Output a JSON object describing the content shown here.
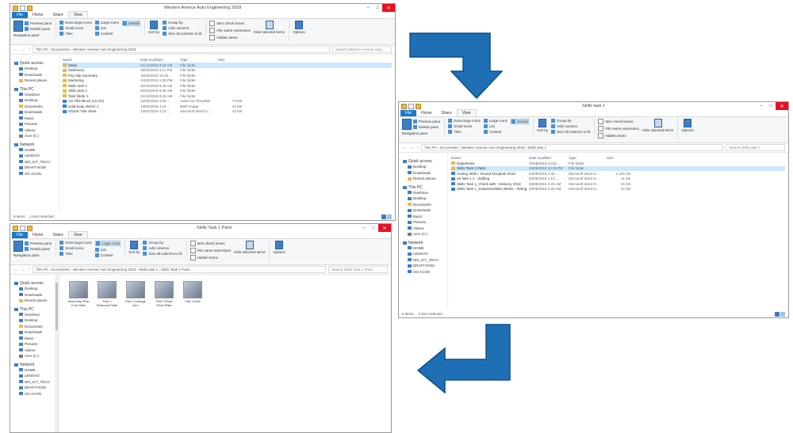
{
  "win1": {
    "title": "Western Avenue Auto Engineering 2018",
    "tabs": [
      "File",
      "Home",
      "Share",
      "View"
    ],
    "ribbon": {
      "nav_pane": "Navigation pane",
      "panes": [
        "Preview pane",
        "Details pane"
      ],
      "layout": [
        "Extra large icons",
        "Large icons",
        "Small icons",
        "List",
        "Tiles",
        "Content"
      ],
      "layout_selected": "Details",
      "sort": "Sort by",
      "current_view": [
        "Group by",
        "Add columns",
        "Size all columns to fit"
      ],
      "show_hide": [
        "Item check boxes",
        "File name extensions",
        "Hidden items"
      ],
      "hide_selected": "Hide selected items",
      "options": "Options"
    },
    "path": "This PC  ›  Documents  ›  Western Avenue Auto Engineering 2018",
    "search_placeholder": "Search Western Avenue Auto...",
    "columns": [
      "Name",
      "Date modified",
      "Type",
      "Size"
    ],
    "files": [
      {
        "name": "Sales",
        "date": "21/12/2018 8:22 AM",
        "type": "File folder",
        "size": "",
        "icon": "folder",
        "selected": true
      },
      {
        "name": "Stationery",
        "date": "18/02/2018 3:11 PM",
        "type": "File folder",
        "size": "",
        "icon": "folder"
      },
      {
        "name": "Pay Slip Summary",
        "date": "15/02/2018 10:05 ...",
        "type": "File folder",
        "size": "",
        "icon": "folder"
      },
      {
        "name": "Marketing",
        "date": "14/02/2018 1:40 PM",
        "type": "File folder",
        "size": "",
        "icon": "folder"
      },
      {
        "name": "Skills task 1",
        "date": "20/12/2018 9:45 AM",
        "type": "File folder",
        "size": "",
        "icon": "folder"
      },
      {
        "name": "Skills task 2",
        "date": "20/12/2018 9:45 AM",
        "type": "File folder",
        "size": "",
        "icon": "folder"
      },
      {
        "name": "Task folder 3",
        "date": "21/12/2018 8:22 AM",
        "type": "File folder",
        "size": "",
        "icon": "folder"
      },
      {
        "name": "AG Title Block (ACAD)",
        "date": "12/02/2018 2:05 ...",
        "type": "AutoCAD Template",
        "size": "73 KB",
        "icon": "doc"
      },
      {
        "name": "solid body sketch 1",
        "date": "13/02/2018 4:10 ...",
        "type": "BMP Image",
        "size": "10 KB",
        "icon": "doc"
      },
      {
        "name": "UNSW Title sheet",
        "date": "13/02/2018 4:22 ...",
        "type": "Microsoft Word D...",
        "size": "12 KB",
        "icon": "doc"
      }
    ],
    "status": [
      "9 items",
      "1 item selected"
    ]
  },
  "win2": {
    "title": "Skills task 1",
    "tabs": [
      "File",
      "Home",
      "Share",
      "View"
    ],
    "ribbon": {
      "nav_pane": "Navigation pane",
      "panes": [
        "Preview pane",
        "Details pane"
      ],
      "layout": [
        "Extra large icons",
        "Large icons",
        "Small icons",
        "List",
        "Tiles",
        "Content"
      ],
      "layout_selected": "Details",
      "sort": "Sort by",
      "current_view": [
        "Group by",
        "Add columns",
        "Size all columns to fit"
      ],
      "show_hide": [
        "Item check boxes",
        "File name extensions",
        "Hidden items"
      ],
      "hide_selected": "Hide selected items",
      "options": "Options"
    },
    "path": "This PC  ›  Documents  ›  Western Avenue Auto Engineering 2018  ›  Skills task 1",
    "search_placeholder": "Search Skills task 1",
    "columns": [
      "Name",
      "Date modified",
      "Type",
      "Size"
    ],
    "files": [
      {
        "name": "Datasheets",
        "date": "20/08/2018 10:52 ...",
        "type": "File folder",
        "size": "",
        "icon": "folder"
      },
      {
        "name": "Skills Task 1 Parts",
        "date": "20/08/2018 12:25 PM",
        "type": "File folder",
        "size": "",
        "icon": "folder",
        "selected": true
      },
      {
        "name": "Anding Skills - Round Template 2018",
        "date": "24/08/2018 1:44 ...",
        "type": "Microsoft Word D...",
        "size": "1,234 KB",
        "icon": "doc"
      },
      {
        "name": "art field 1.1 - drafting",
        "date": "20/08/2018 1:13 ...",
        "type": "Microsoft Word D...",
        "size": "11 KB",
        "icon": "doc"
      },
      {
        "name": "Skills Task 1_Check with - Delivery 2018",
        "date": "20/08/2018 4:25 AM",
        "type": "Microsoft Word D...",
        "size": "24 KB",
        "icon": "doc"
      },
      {
        "name": "Skills Task 1_Subassemblies Wides - Wiring",
        "date": "20/08/2018 4:25 AM",
        "type": "Microsoft Word D...",
        "size": "22 KB",
        "icon": "doc"
      }
    ],
    "status": [
      "6 items",
      "1 item selected"
    ]
  },
  "win3": {
    "title": "Skills Task 1 Parts",
    "tabs": [
      "File",
      "Home",
      "Share",
      "View"
    ],
    "ribbon": {
      "nav_pane": "Navigation pane",
      "panes": [
        "Preview pane",
        "Details pane"
      ],
      "layout": [
        "Extra large icons",
        "Large icons",
        "Small icons",
        "List",
        "Tiles",
        "Content"
      ],
      "layout_selected": "Large icons",
      "sort": "Sort by",
      "current_view": [
        "Group by",
        "Add columns",
        "Size all columns to fit"
      ],
      "show_hide": [
        "Item check boxes",
        "File name extensions",
        "Hidden items"
      ],
      "hide_selected": "Hide selected items",
      "options": "Options"
    },
    "path": "This PC  ›  Documents  ›  Western Avenue Auto Engineering 2018  ›  Skills task 1  ›  Skills Task 1 Parts",
    "search_placeholder": "Search Skills Task 1 Parts",
    "thumbnails": [
      "Assembly Rear Fork Main",
      "Part 1 Rebound Plate",
      "Part 2 Linkage Arm",
      "Part 3 Rear Pivot Plate",
      "Part 4 Axle"
    ]
  },
  "nav": {
    "quick_access": "Quick access",
    "quick_items": [
      "Desktop",
      "Downloads",
      "Recent places"
    ],
    "this_pc": "This PC",
    "pc_items": [
      "OneDrive",
      "Desktop",
      "Documents",
      "Downloads",
      "Music",
      "Pictures",
      "Videos",
      "Acer (C:)"
    ],
    "network": "Network",
    "network_items": [
      "HOME",
      "LENOVO",
      "WS_ICT_TECH",
      "DRAFT-ROM",
      "SG-ACON"
    ]
  },
  "colors": {
    "accent": "#1979ca",
    "arrow": "#1f6fb5",
    "select": "#cce8ff",
    "close": "#e81123"
  }
}
